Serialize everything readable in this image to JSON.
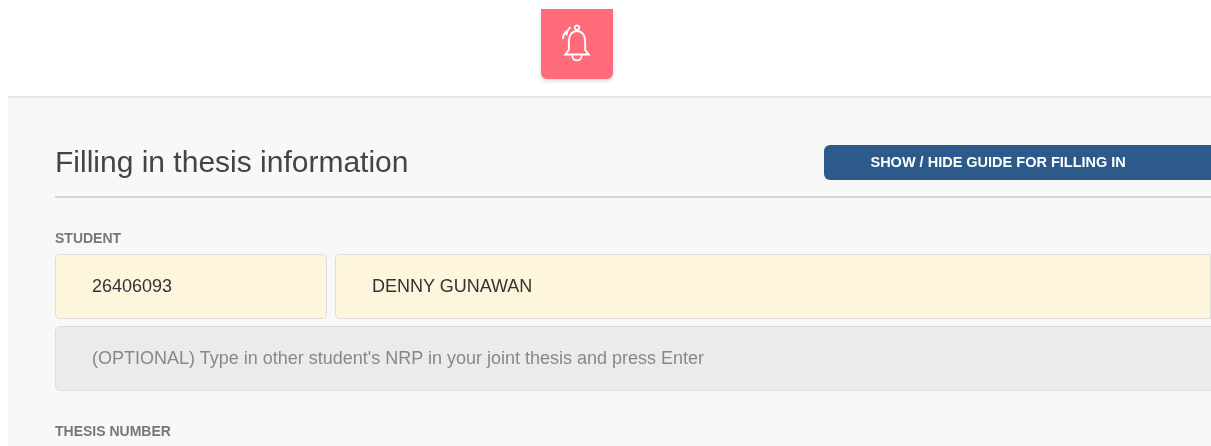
{
  "page": {
    "title": "Filling in thesis information",
    "guide_button": "SHOW / HIDE GUIDE FOR FILLING IN"
  },
  "student": {
    "label": "STUDENT",
    "nrp": "26406093",
    "name": "DENNY GUNAWAN",
    "other_student": {
      "placeholder": "(OPTIONAL) Type in other student's NRP in your joint thesis and press Enter"
    }
  },
  "thesis_number": {
    "label": "THESIS NUMBER"
  }
}
